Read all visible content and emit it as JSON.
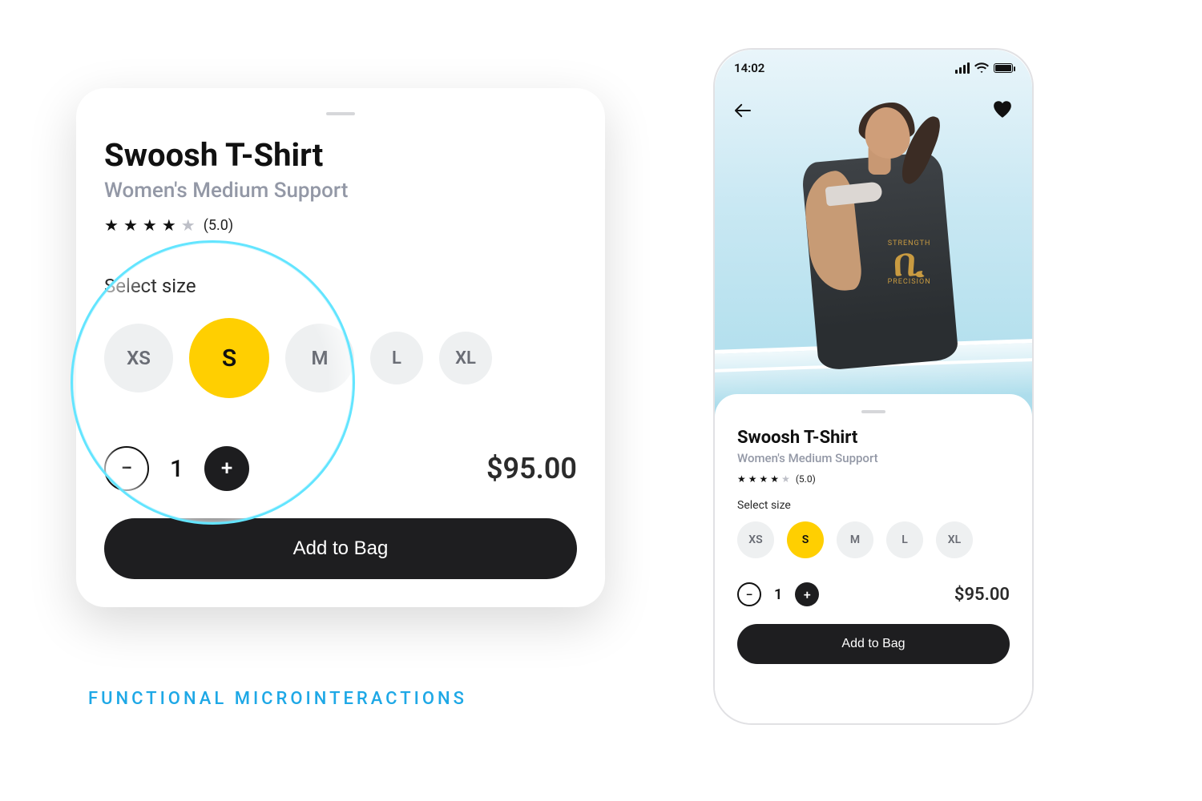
{
  "caption": "FUNCTIONAL MICROINTERACTIONS",
  "colors": {
    "accent_yellow": "#ffcf01",
    "size_idle_bg": "#eef0f1",
    "size_idle_text": "#6a6d75",
    "magnifier_ring": "#63e5ff",
    "caption_blue": "#1ea8e6"
  },
  "status_bar": {
    "time": "14:02"
  },
  "product": {
    "title": "Swoosh T-Shirt",
    "subtitle": "Women's Medium Support",
    "rating": {
      "stars_filled": 4,
      "stars_total": 5,
      "value_text": "(5.0)"
    },
    "select_size_label": "Select size",
    "sizes": [
      "XS",
      "S",
      "M",
      "L",
      "XL"
    ],
    "selected_size": "S",
    "quantity": "1",
    "price": "$95.00",
    "add_to_bag_label": "Add to Bag"
  },
  "size_meta": {
    "left_card_diameters": {
      "XS": 86,
      "S": 100,
      "M": 86,
      "L": 66,
      "XL": 66
    },
    "left_card_font": {
      "XS": 24,
      "S": 30,
      "M": 24,
      "L": 22,
      "XL": 22
    }
  }
}
